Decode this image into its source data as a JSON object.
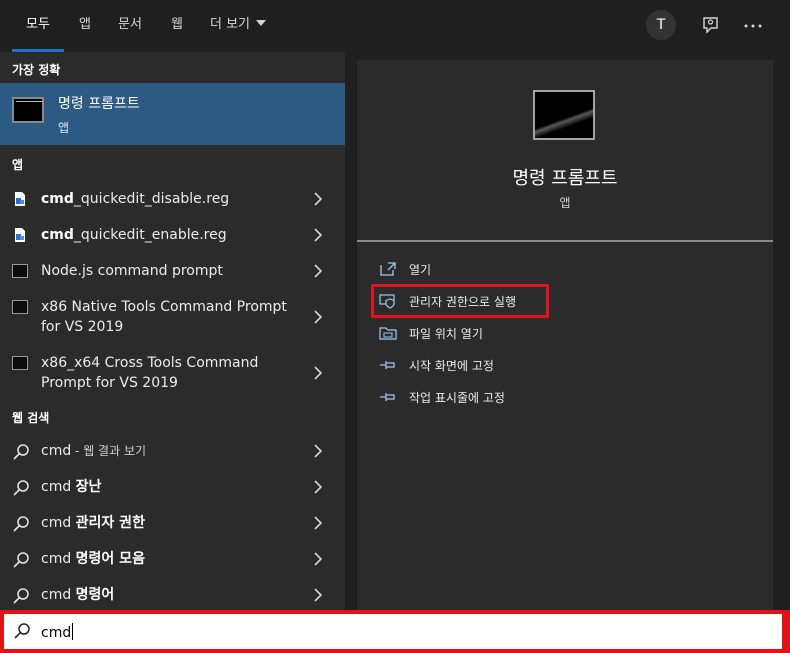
{
  "tabs": [
    {
      "label": "모두",
      "active": true
    },
    {
      "label": "앱"
    },
    {
      "label": "문서"
    },
    {
      "label": "웹"
    },
    {
      "label": "더 보기"
    }
  ],
  "header": {
    "avatar_initial": "T"
  },
  "left": {
    "best_match_label": "가장 정확",
    "best_match": {
      "title": "명령 프롬프트",
      "subtitle": "앱"
    },
    "apps_label": "앱",
    "apps": [
      {
        "bold": "cmd",
        "rest": "_quickedit_disable.reg",
        "icon": "reg-file-icon"
      },
      {
        "bold": "cmd",
        "rest": "_quickedit_enable.reg",
        "icon": "reg-file-icon"
      },
      {
        "bold": "",
        "rest": "Node.js command prompt",
        "icon": "console-icon"
      },
      {
        "bold": "",
        "rest": "x86 Native Tools Command Prompt",
        "rest2": "for VS 2019",
        "icon": "console-icon"
      },
      {
        "bold": "",
        "rest": "x86_x64 Cross Tools Command",
        "rest2": "Prompt for VS 2019",
        "icon": "console-icon"
      }
    ],
    "web_label": "웹 검색",
    "web": [
      {
        "prefix": "cmd",
        "suffix": " - 웹 결과 보기",
        "bold": false
      },
      {
        "prefix": "cmd ",
        "suffix": "장난",
        "bold": true
      },
      {
        "prefix": "cmd ",
        "suffix": "관리자 권한",
        "bold": true
      },
      {
        "prefix": "cmd ",
        "suffix": "명령어 모음",
        "bold": true
      },
      {
        "prefix": "cmd ",
        "suffix": "명령어",
        "bold": true
      }
    ]
  },
  "right": {
    "title": "명령 프롬프트",
    "subtitle": "앱",
    "actions": [
      {
        "label": "열기",
        "icon": "open-icon"
      },
      {
        "label": "관리자 권한으로 실행",
        "icon": "shield-icon"
      },
      {
        "label": "파일 위치 열기",
        "icon": "folder-icon"
      },
      {
        "label": "시작 화면에 고정",
        "icon": "pin-icon"
      },
      {
        "label": "작업 표시줄에 고정",
        "icon": "pin-icon"
      }
    ]
  },
  "search": {
    "value": "cmd"
  },
  "colors": {
    "accent": "#1a73c8",
    "highlight": "#e0121a",
    "selected": "#2c5a82"
  }
}
